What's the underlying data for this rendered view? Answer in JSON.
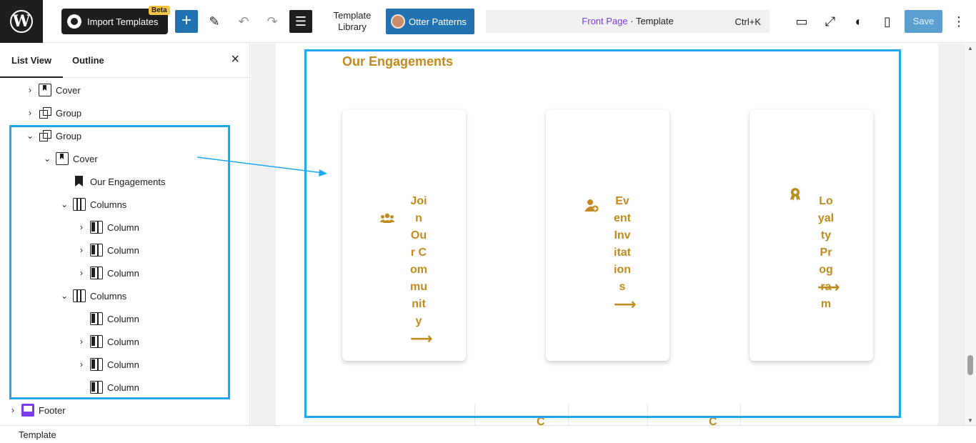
{
  "topbar": {
    "import_label": "Import Templates",
    "beta_badge": "Beta",
    "template_library_label": "Template Library",
    "otter_label": "Otter Patterns",
    "doc_page_name": "Front Page",
    "doc_suffix": " · Template",
    "doc_shortcut": "Ctrl+K",
    "save_label": "Save"
  },
  "sidebar": {
    "tab_list_view": "List View",
    "tab_outline": "Outline",
    "close_glyph": "×",
    "items": [
      {
        "label": "Cover",
        "icon": "cover-icon",
        "chevron": "›"
      },
      {
        "label": "Group",
        "icon": "group-icon",
        "chevron": "›"
      },
      {
        "label": "Group",
        "icon": "group-icon",
        "chevron": "⌄"
      },
      {
        "label": "Cover",
        "icon": "cover-icon",
        "chevron": "⌄"
      },
      {
        "label": "Our Engagements",
        "icon": "heading-icon",
        "chevron": ""
      },
      {
        "label": "Columns",
        "icon": "columns-icon",
        "chevron": "⌄"
      },
      {
        "label": "Column",
        "icon": "column-icon",
        "chevron": "›"
      },
      {
        "label": "Column",
        "icon": "column-icon",
        "chevron": "›"
      },
      {
        "label": "Column",
        "icon": "column-icon",
        "chevron": "›"
      },
      {
        "label": "Columns",
        "icon": "columns-icon",
        "chevron": "⌄"
      },
      {
        "label": "Column",
        "icon": "column-icon",
        "chevron": ""
      },
      {
        "label": "Column",
        "icon": "column-icon",
        "chevron": "›"
      },
      {
        "label": "Column",
        "icon": "column-icon",
        "chevron": "›"
      },
      {
        "label": "Column",
        "icon": "column-icon",
        "chevron": ""
      },
      {
        "label": "Footer",
        "icon": "footer-icon",
        "chevron": "›"
      }
    ]
  },
  "canvas": {
    "heading": "Our Engagements",
    "cards": [
      {
        "text": "Join Our Community",
        "icon": "users-icon",
        "arrow": "⟶"
      },
      {
        "text": "Event  Invitations",
        "icon": "user-plus-icon",
        "arrow": "⟶"
      },
      {
        "text": "Loyalty Program",
        "icon": "award-icon",
        "arrow": "⟶"
      }
    ],
    "lower_letter": "C"
  },
  "status": {
    "label": "Template"
  },
  "colors": {
    "accent": "#c08a1e",
    "highlight": "#1ea7f2",
    "primary": "#2271b1",
    "footer_icon": "#7c3aed"
  }
}
